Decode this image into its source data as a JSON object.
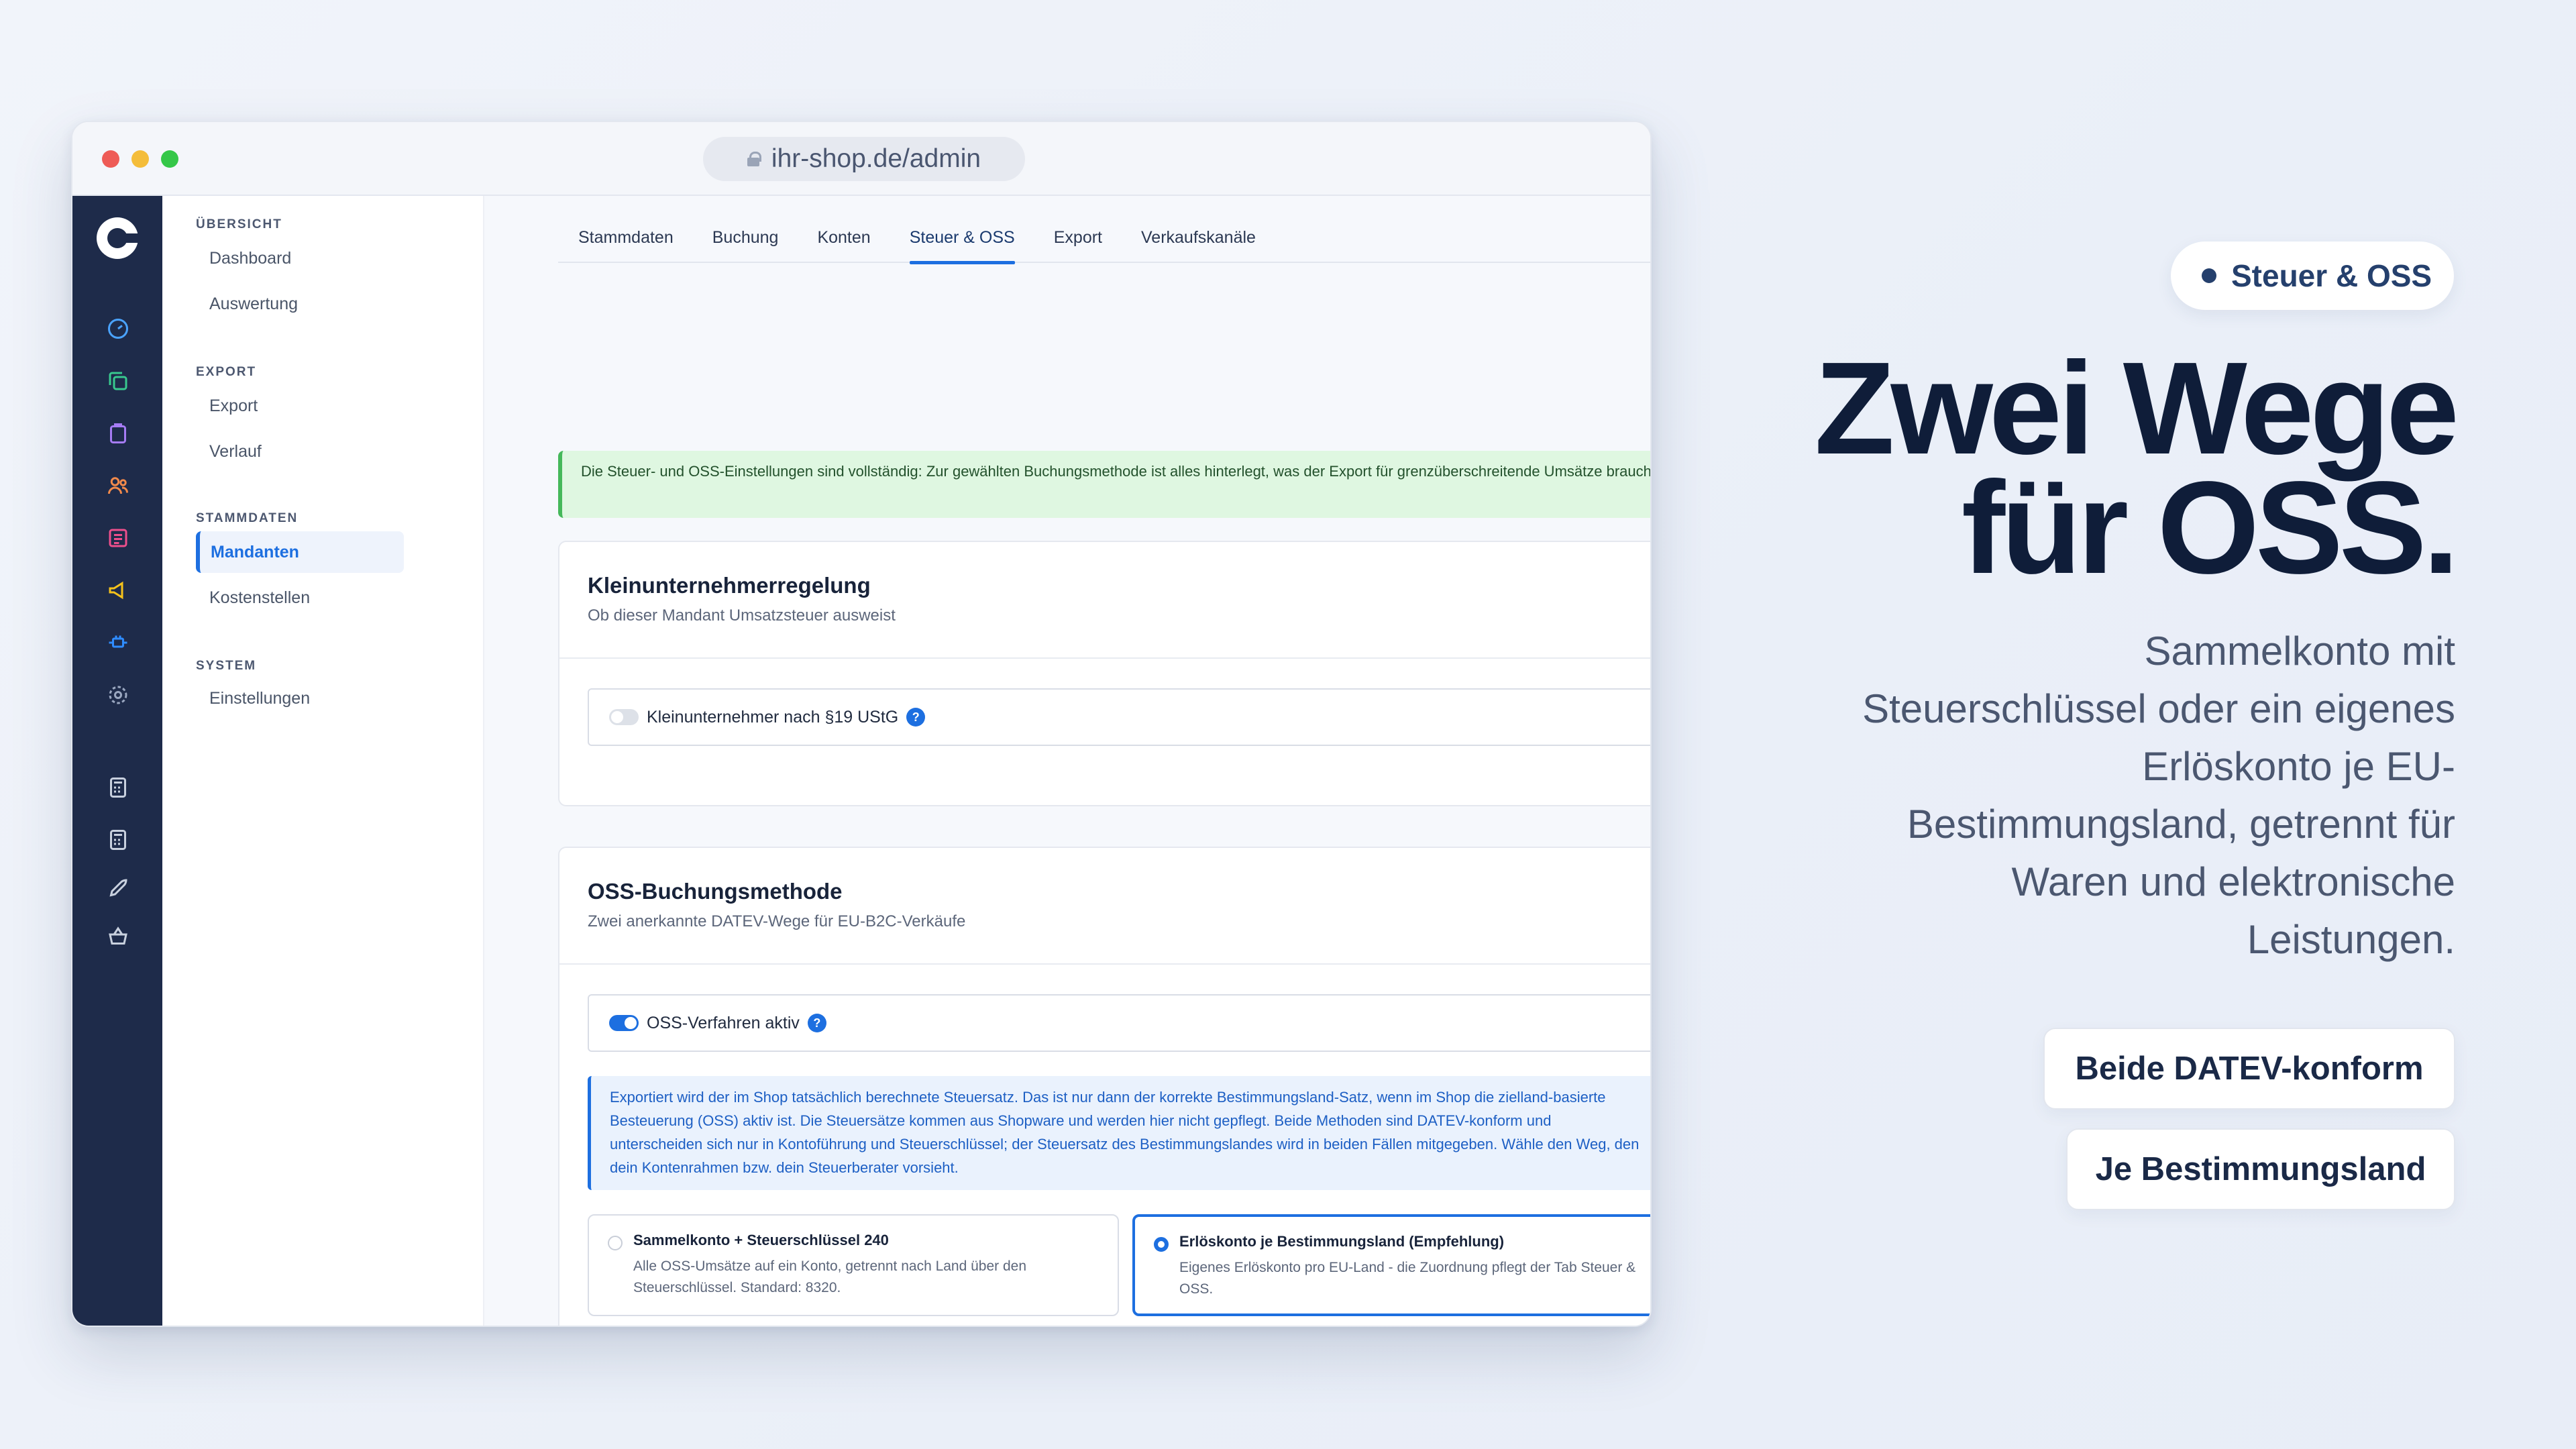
{
  "browser": {
    "url": "ihr-shop.de/admin"
  },
  "subnav": {
    "sections": [
      {
        "label": "ÜBERSICHT",
        "items": [
          "Dashboard",
          "Auswertung"
        ]
      },
      {
        "label": "EXPORT",
        "items": [
          "Export",
          "Verlauf"
        ]
      },
      {
        "label": "STAMMDATEN",
        "items": [
          "Mandanten",
          "Kostenstellen"
        ]
      },
      {
        "label": "SYSTEM",
        "items": [
          "Einstellungen"
        ]
      }
    ],
    "active_item": "Mandanten"
  },
  "rail_icons": [
    "dashboard-gauge-icon",
    "copy-icon",
    "clipboard-icon",
    "users-icon",
    "list-icon",
    "megaphone-icon",
    "plug-icon",
    "settings-gear-icon",
    "calculator-icon",
    "calculator-icon",
    "rocket-icon",
    "basket-icon"
  ],
  "tabs": [
    "Stammdaten",
    "Buchung",
    "Konten",
    "Steuer & OSS",
    "Export",
    "Verkaufskanäle"
  ],
  "active_tab": "Steuer & OSS",
  "alert": "Die Steuer- und OSS-Einstellungen sind vollständig: Zur gewählten Buchungsmethode ist alles hinterlegt, was der Export für grenzüberschreitende Umsätze braucht.",
  "card_kleinunternehmer": {
    "title": "Kleinunternehmerregelung",
    "subtitle": "Ob dieser Mandant Umsatzsteuer ausweist",
    "toggle_label": "Kleinunternehmer nach §19 UStG",
    "toggle_on": false,
    "help": "?"
  },
  "card_oss": {
    "title": "OSS-Buchungsmethode",
    "subtitle": "Zwei anerkannte DATEV-Wege für EU-B2C-Verkäufe",
    "toggle_label": "OSS-Verfahren aktiv",
    "toggle_on": true,
    "help": "?",
    "info": "Exportiert wird der im Shop tatsächlich berechnete Steuersatz. Das ist nur dann der korrekte Bestimmungsland-Satz, wenn im Shop die zielland-basierte Besteuerung (OSS) aktiv ist. Die Steuersätze kommen aus Shopware und werden hier nicht gepflegt. Beide Methoden sind DATEV-konform und unterscheiden sich nur in Kontoführung und Steuerschlüssel; der Steuersatz des Bestimmungslandes wird in beiden Fällen mitgegeben. Wähle den Weg, den dein Kontenrahmen bzw. dein Steuerberater vorsieht.",
    "options": [
      {
        "title": "Sammelkonto + Steuerschlüssel 240",
        "desc": "Alle OSS-Umsätze auf ein Konto, getrennt nach Land über den Steuerschlüssel. Standard: 8320.",
        "selected": false
      },
      {
        "title": "Erlöskonto je Bestimmungsland (Empfehlung)",
        "desc": "Eigenes Erlöskonto pro EU-Land - die Zuordnung pflegt der Tab Steuer & OSS.",
        "selected": true
      }
    ]
  },
  "marketing": {
    "chip": "Steuer & OSS",
    "headline_line1": "Zwei Wege",
    "headline_line2": "für OSS.",
    "subline": "Sammelkonto mit Steuerschlüssel oder ein eigenes Erlöskonto je EU-Bestimmungsland, getrennt für Waren und elektronische Leistungen.",
    "pills": [
      "Beide DATEV-konform",
      "Je Bestimmungsland"
    ]
  },
  "colors": {
    "accent": "#1d6fe0",
    "rail": "#1e2b4a",
    "success_bg": "#dff7e1",
    "headline": "#0f1d39"
  }
}
